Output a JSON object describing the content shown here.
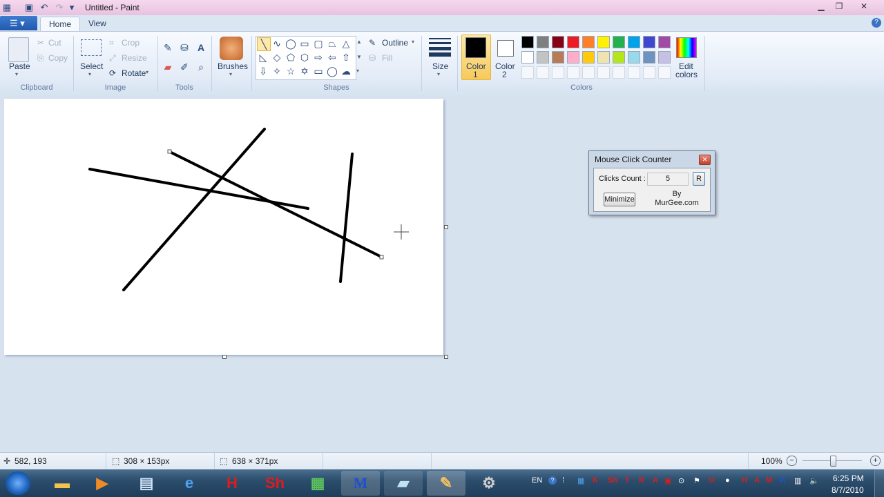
{
  "window": {
    "title": "Untitled - Paint"
  },
  "tabs": [
    {
      "label": "Home"
    },
    {
      "label": "View"
    }
  ],
  "clipboard": {
    "paste": "Paste",
    "cut": "Cut",
    "copy": "Copy",
    "group": "Clipboard"
  },
  "image": {
    "select": "Select",
    "crop": "Crop",
    "resize": "Resize",
    "rotate": "Rotate",
    "group": "Image"
  },
  "tools": {
    "group": "Tools"
  },
  "brushes": {
    "label": "Brushes"
  },
  "shapes": {
    "outline": "Outline",
    "fill": "Fill",
    "group": "Shapes"
  },
  "size": {
    "label": "Size"
  },
  "colors": {
    "color1_label": "Color",
    "color1_num": "1",
    "color2_label": "Color",
    "color2_num": "2",
    "edit_label": "Edit",
    "edit_label2": "colors",
    "group": "Colors",
    "color1_value": "#000000",
    "color2_value": "#ffffff",
    "palette_row1": [
      "#000000",
      "#7f7f7f",
      "#880015",
      "#ed1c24",
      "#ff7f27",
      "#fff200",
      "#22b14c",
      "#00a2e8",
      "#3f48cc",
      "#a349a4"
    ],
    "palette_row2": [
      "#ffffff",
      "#c3c3c3",
      "#b97a57",
      "#ffaec9",
      "#ffc90e",
      "#efe4b0",
      "#b5e61d",
      "#99d9ea",
      "#7092be",
      "#c8bfe7"
    ]
  },
  "dialog": {
    "title": "Mouse Click Counter",
    "clicks_label": "Clicks Count :",
    "clicks_value": "5",
    "reset": "R",
    "minimize": "Minimize",
    "by": "By",
    "by2": "MurGee.com"
  },
  "status": {
    "cursor_pos": "582, 193",
    "selection_size": "308 × 153px",
    "canvas_size": "638 × 371px",
    "zoom": "100%"
  },
  "taskbar": {
    "lang": "EN",
    "time": "6:25 PM",
    "date": "8/7/2010"
  }
}
